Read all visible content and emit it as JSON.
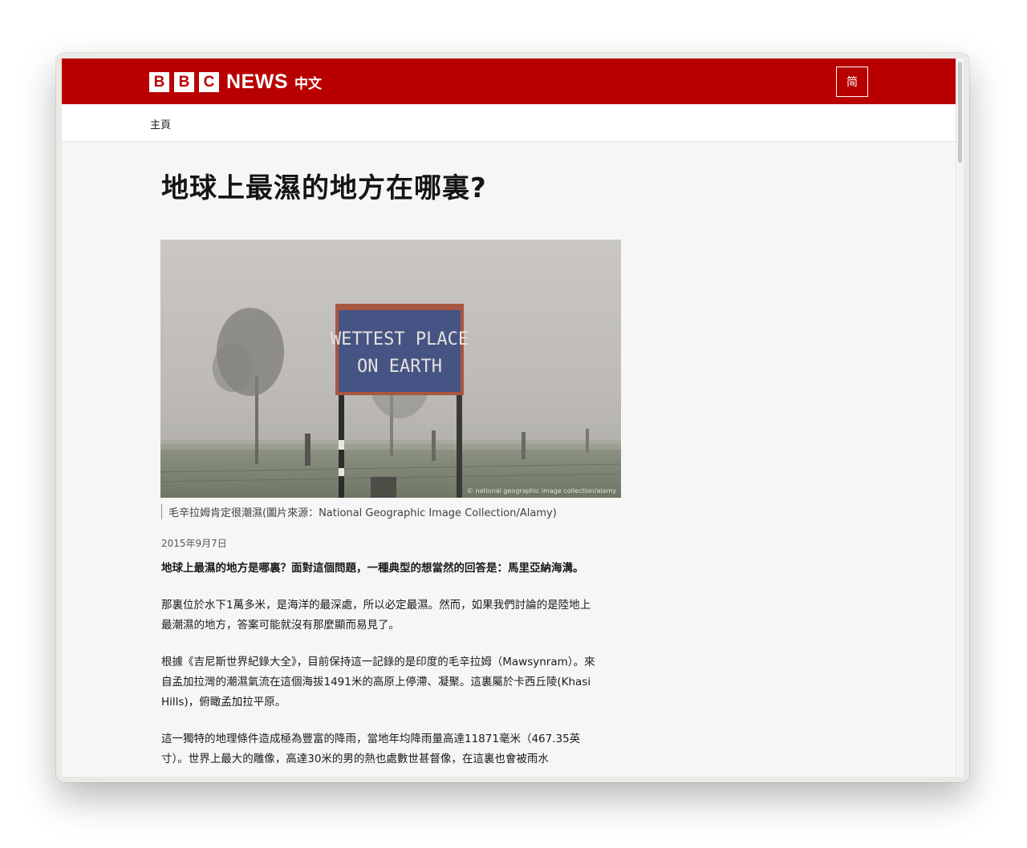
{
  "header": {
    "logo_letters": [
      "B",
      "B",
      "C"
    ],
    "logo_news": "NEWS",
    "logo_lang": "中文",
    "script_toggle": "简",
    "brand_color": "#b80000"
  },
  "nav": {
    "home_label": "主頁"
  },
  "article": {
    "title": "地球上最濕的地方在哪裏?",
    "image": {
      "sign_line1": "WETTEST PLACE",
      "sign_line2": "ON EARTH",
      "credit": "© national geographic image collection/alamy"
    },
    "caption": "毛辛拉姆肯定很潮濕(圖片來源：National Geographic Image Collection/Alamy)",
    "date": "2015年9月7日",
    "paragraphs": [
      "地球上最濕的地方是哪裏？面對這個問題，一種典型的想當然的回答是：馬里亞納海溝。",
      "那裏位於水下1萬多米，是海洋的最深處，所以必定最濕。然而，如果我們討論的是陸地上最潮濕的地方，答案可能就沒有那麼顯而易見了。",
      "根據《吉尼斯世界紀錄大全》，目前保持這一記錄的是印度的毛辛拉姆（Mawsynram）。來自孟加拉灣的潮濕氣流在這個海拔1491米的高原上停滯、凝聚。這裏屬於卡西丘陵(Khasi Hills)，俯瞰孟加拉平原。",
      "這一獨特的地理條件造成極為豐富的降雨，當地年均降雨量高達11871毫米（467.35英寸）。世界上最大的雕像，高達30米的男的熱也處數世甚督像，在這裏也會被雨水"
    ]
  }
}
